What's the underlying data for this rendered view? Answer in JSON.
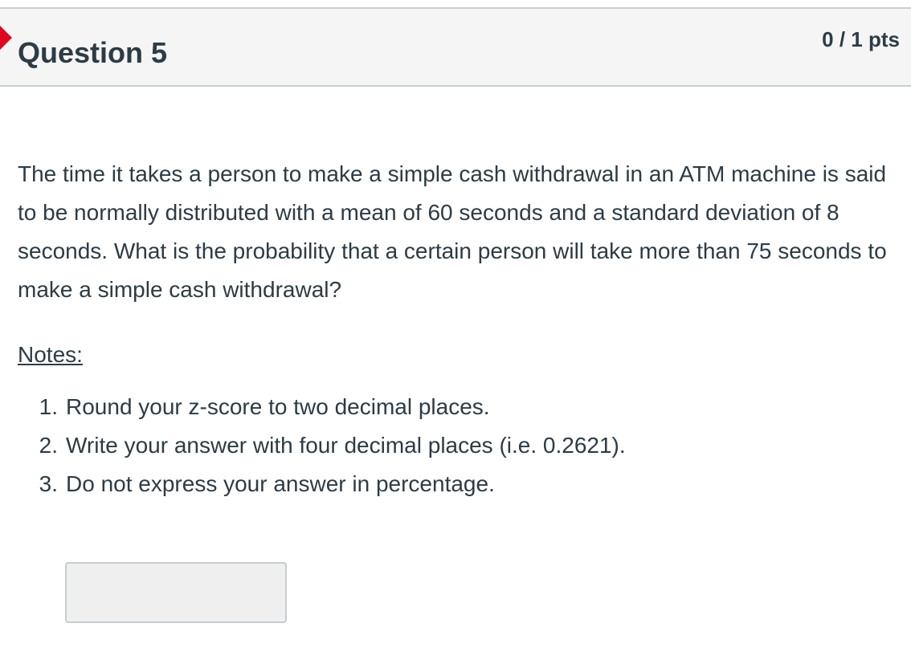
{
  "question": {
    "title": "Question 5",
    "points": "0 / 1 pts",
    "status_color": "#e0061f",
    "text": "The time it takes a person to make a simple cash withdrawal in an ATM machine is said to be normally distributed with a mean of 60 seconds and a standard deviation of 8 seconds. What is the probability that a certain person will take more than 75 seconds to make a simple cash withdrawal?",
    "notes_heading": "Notes:",
    "notes": [
      {
        "number": "1.",
        "text": "Round your z-score to two decimal places."
      },
      {
        "number": "2.",
        "text": "Write your answer with four decimal places (i.e. 0.2621)."
      },
      {
        "number": "3.",
        "text": "Do not express your answer in percentage."
      }
    ],
    "answer": {
      "value": "",
      "placeholder": ""
    }
  }
}
